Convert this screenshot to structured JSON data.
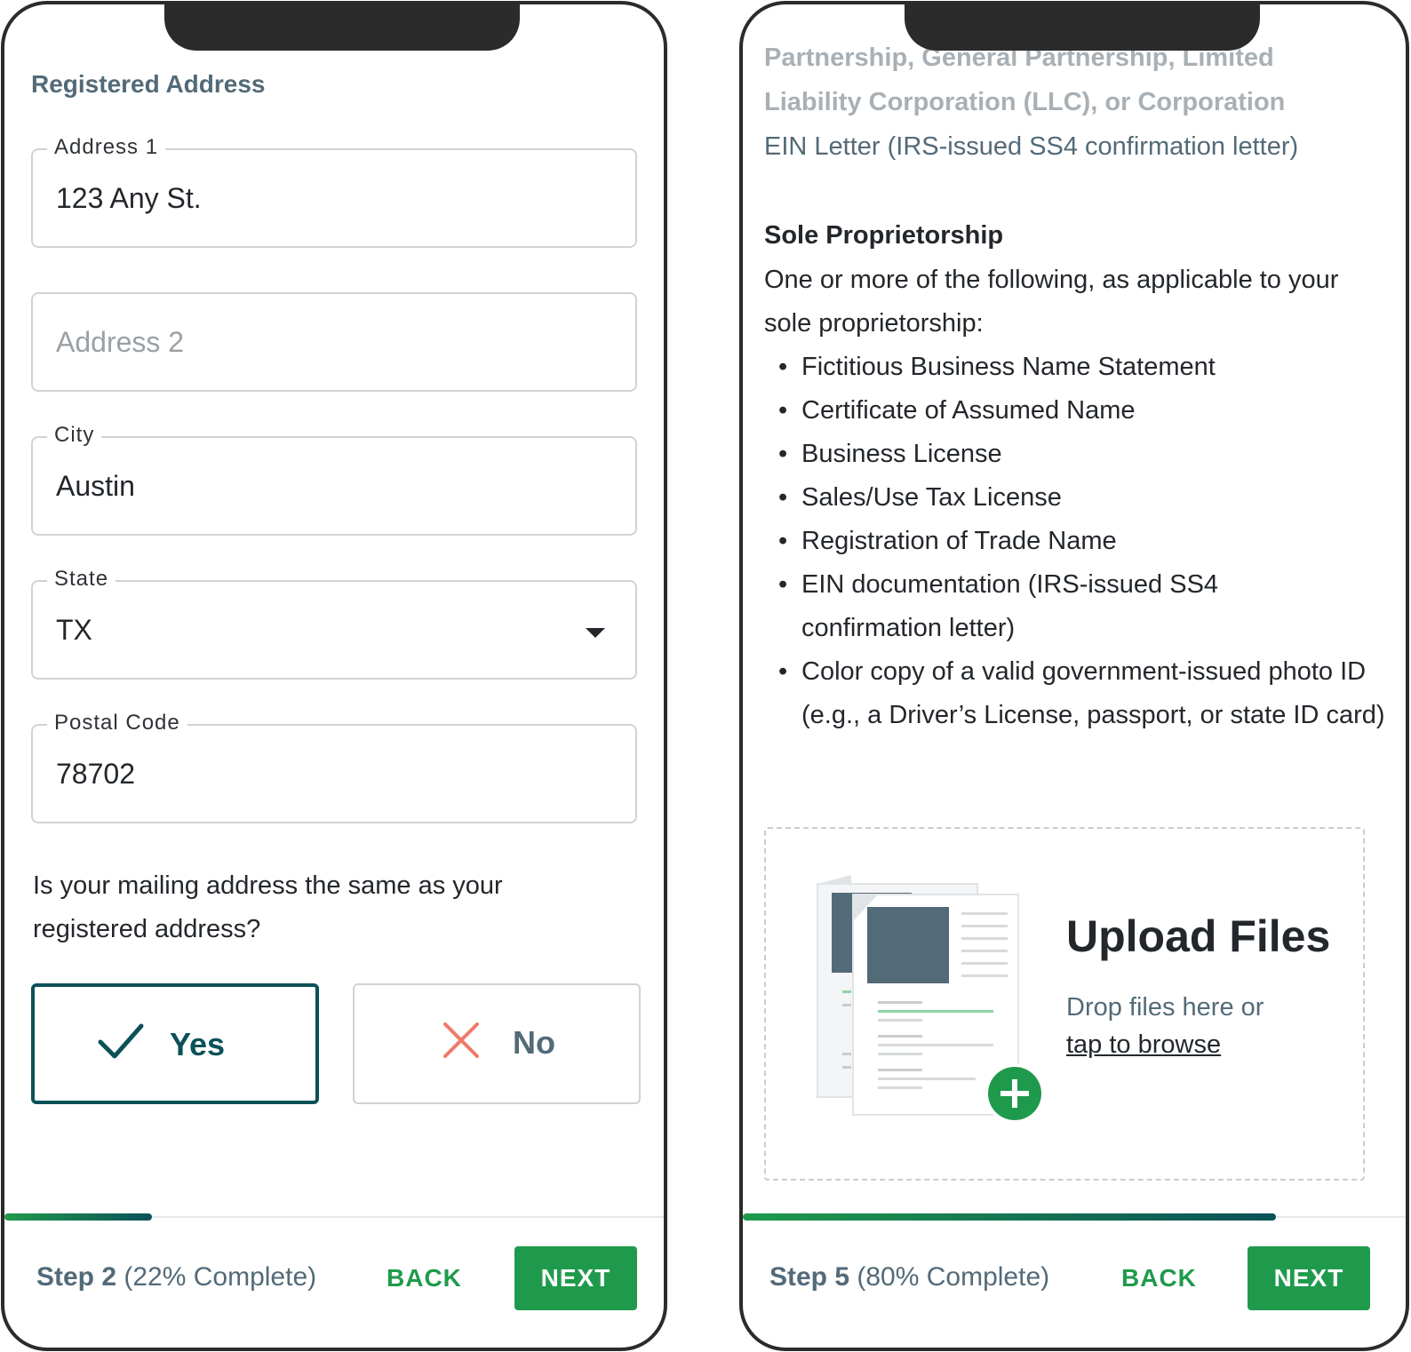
{
  "left_screen": {
    "section_title": "Registered Address",
    "fields": {
      "address1": {
        "label": "Address 1",
        "value": "123 Any St."
      },
      "address2": {
        "placeholder": "Address 2"
      },
      "city": {
        "label": "City",
        "value": "Austin"
      },
      "state": {
        "label": "State",
        "value": "TX"
      },
      "postal": {
        "label": "Postal Code",
        "value": "78702"
      }
    },
    "question": "Is your mailing address the same as your registered address?",
    "choices": {
      "yes": "Yes",
      "no": "No",
      "selected": "yes"
    },
    "progress": {
      "step_label": "Step 2",
      "percent_label": "(22% Complete)",
      "fraction": 0.22
    },
    "back_label": "BACK",
    "next_label": "NEXT"
  },
  "right_screen": {
    "faded_line_1": "Partnership, General Partnership, Limited",
    "faded_line_2": "Liability Corporation (LLC), or Corporation",
    "ein_line": "EIN Letter (IRS-issued SS4 confirmation letter)",
    "sp_title": "Sole Proprietorship",
    "sp_desc": "One or more of the following, as applicable to your sole proprietorship:",
    "sp_items": [
      "Fictitious Business Name Statement",
      "Certificate of Assumed Name",
      "Business License",
      "Sales/Use Tax License",
      "Registration of Trade Name",
      "EIN documentation (IRS-issued SS4 confirmation letter)",
      "Color copy of a valid government-issued photo ID (e.g., a Driver’s License, passport, or state ID card)"
    ],
    "upload": {
      "title": "Upload Files",
      "subtitle": "Drop files here or",
      "link": "tap to browse",
      "add_icon": "plus-circle-icon"
    },
    "progress": {
      "step_label": "Step 5",
      "percent_label": "(80% Complete)",
      "fraction": 0.8
    },
    "back_label": "BACK",
    "next_label": "NEXT"
  },
  "colors": {
    "brand_green": "#1f9a4c",
    "teal": "#0b5158",
    "slate": "#536a78",
    "error_red": "#f07a6a"
  }
}
